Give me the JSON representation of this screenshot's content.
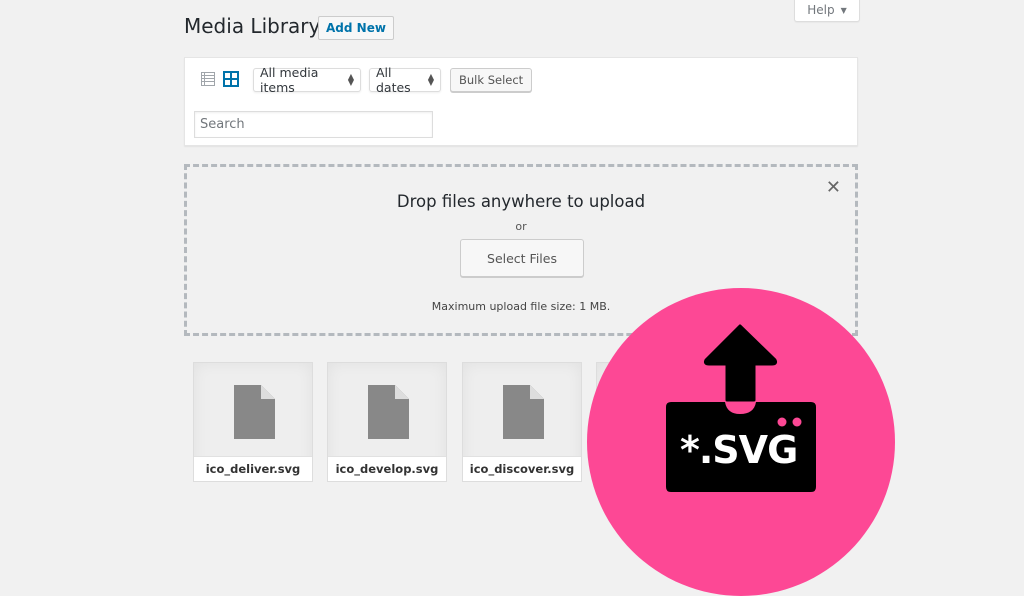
{
  "header": {
    "title": "Media Library",
    "add_new_label": "Add New",
    "help_label": "Help",
    "help_icon": "triangle-down-icon"
  },
  "toolbar": {
    "view_modes": [
      {
        "name": "list-view",
        "icon": "list-icon",
        "active": false
      },
      {
        "name": "grid-view",
        "icon": "grid-icon",
        "active": true
      }
    ],
    "media_filter": {
      "selected": "All media items"
    },
    "date_filter": {
      "selected": "All dates"
    },
    "bulk_select_label": "Bulk Select",
    "search": {
      "value": "",
      "placeholder": "Search"
    }
  },
  "uploader": {
    "title": "Drop files anywhere to upload",
    "or_text": "or",
    "select_files_label": "Select Files",
    "max_size_text": "Maximum upload file size: 1 MB.",
    "close_icon": "close-icon"
  },
  "attachments": [
    {
      "filename": "ico_deliver.svg",
      "icon": "document-icon"
    },
    {
      "filename": "ico_develop.svg",
      "icon": "document-icon"
    },
    {
      "filename": "ico_discover.svg",
      "icon": "document-icon"
    },
    {
      "filename": "",
      "icon": "document-icon"
    }
  ],
  "badge": {
    "label": "*.SVG",
    "icon": "upload-arrow-icon",
    "color": "#fd4895"
  },
  "colors": {
    "accent": "#0073aa",
    "background": "#f1f1f1",
    "badge_pink": "#fd4895"
  }
}
